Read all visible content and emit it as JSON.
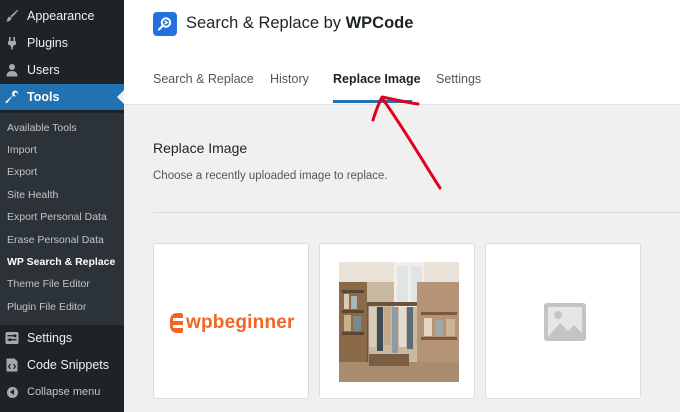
{
  "sidebar": {
    "top_items": [
      {
        "label": "Appearance",
        "icon": "paintbrush-icon"
      },
      {
        "label": "Plugins",
        "icon": "plug-icon"
      },
      {
        "label": "Users",
        "icon": "user-icon"
      },
      {
        "label": "Tools",
        "icon": "wrench-icon",
        "active": true
      }
    ],
    "submenu": [
      "Available Tools",
      "Import",
      "Export",
      "Site Health",
      "Export Personal Data",
      "Erase Personal Data",
      "WP Search & Replace",
      "Theme File Editor",
      "Plugin File Editor"
    ],
    "current_submenu": "WP Search & Replace",
    "bottom_items": [
      {
        "label": "Settings",
        "icon": "settings-icon"
      },
      {
        "label": "Code Snippets",
        "icon": "code-icon"
      }
    ],
    "collapse_label": "Collapse menu"
  },
  "header": {
    "title_prefix": "Search & Replace by ",
    "title_brand": "WPCode",
    "logo_icon": "search-replace-logo-icon"
  },
  "tabs": [
    {
      "label": "Search & Replace"
    },
    {
      "label": "History"
    },
    {
      "label": "Replace Image",
      "active": true
    },
    {
      "label": "Settings"
    }
  ],
  "content": {
    "title": "Replace Image",
    "description": "Choose a recently uploaded image to replace."
  },
  "images": [
    {
      "type": "logo",
      "text": "wpbeginner"
    },
    {
      "type": "photo",
      "icon": "store-photo"
    },
    {
      "type": "placeholder",
      "icon": "image-placeholder-icon"
    }
  ],
  "colors": {
    "sidebar_bg": "#1d2327",
    "submenu_bg": "#2c3338",
    "active_blue": "#2271b1",
    "logo_blue": "#2271e0",
    "wpbeginner_orange": "#f26522",
    "annotation_red": "#e3001b"
  }
}
